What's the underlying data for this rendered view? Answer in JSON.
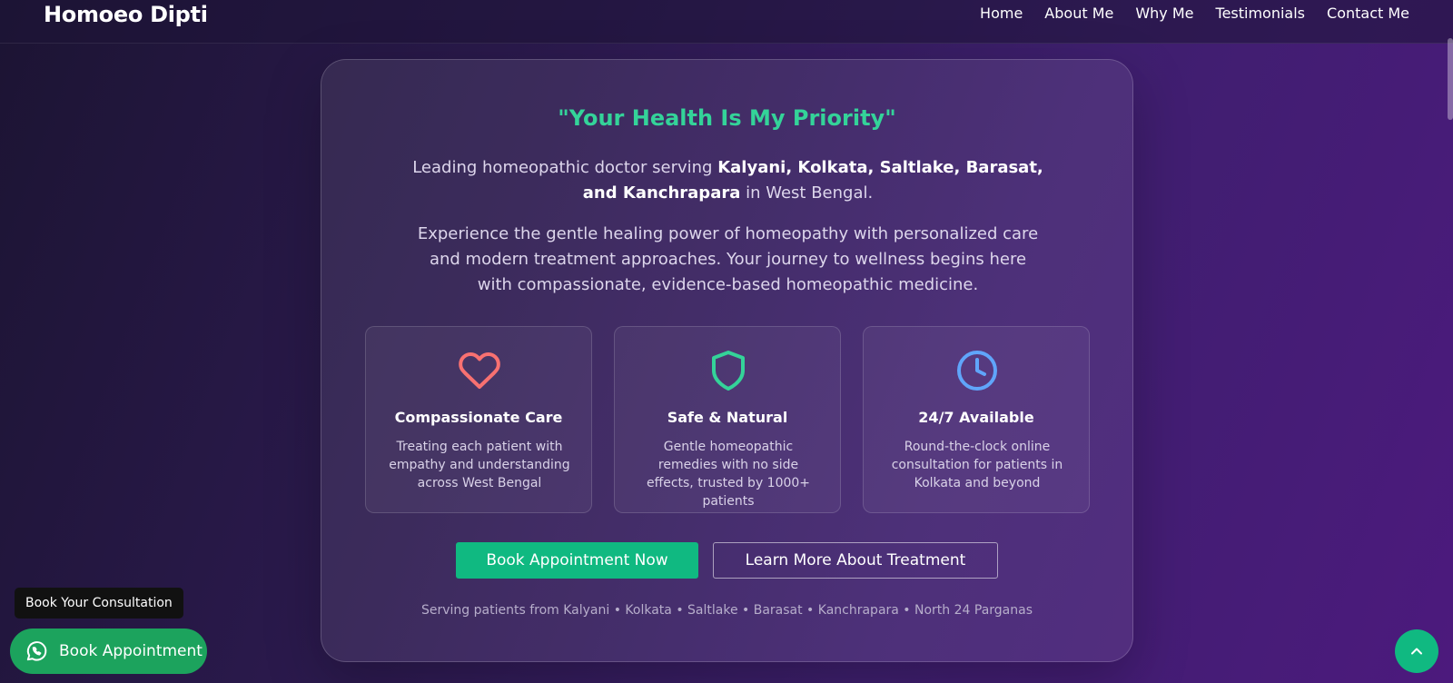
{
  "header": {
    "brand": "Homoeo Dipti",
    "nav": [
      "Home",
      "About Me",
      "Why Me",
      "Testimonials",
      "Contact Me"
    ]
  },
  "hero": {
    "tagline": "\"Your Health Is My Priority\"",
    "lead_prefix": "Leading homeopathic doctor serving ",
    "lead_locations": "Kalyani, Kolkata, Saltlake, Barasat, and Kanchrapara",
    "lead_suffix": " in West Bengal.",
    "description": "Experience the gentle healing power of homeopathy with personalized care and modern treatment approaches. Your journey to wellness begins here with compassionate, evidence-based homeopathic medicine.",
    "features": [
      {
        "icon": "heart-icon",
        "title": "Compassionate Care",
        "text": "Treating each patient with empathy and understanding across West Bengal",
        "color": "#f87171"
      },
      {
        "icon": "shield-icon",
        "title": "Safe & Natural",
        "text": "Gentle homeopathic remedies with no side effects, trusted by 1000+ patients",
        "color": "#34d399"
      },
      {
        "icon": "clock-icon",
        "title": "24/7 Available",
        "text": "Round-the-clock online consultation for patients in Kolkata and beyond",
        "color": "#60a5fa"
      }
    ],
    "primary_button": "Book Appointment Now",
    "secondary_button": "Learn More About Treatment",
    "serving": "Serving patients from Kalyani • Kolkata • Saltlake • Barasat • Kanchrapara • North 24 Parganas"
  },
  "floating": {
    "tooltip": "Book Your Consultation",
    "whatsapp_button": "Book Appointment"
  },
  "colors": {
    "accent": "#10b981",
    "whatsapp": "#1ca35d"
  }
}
